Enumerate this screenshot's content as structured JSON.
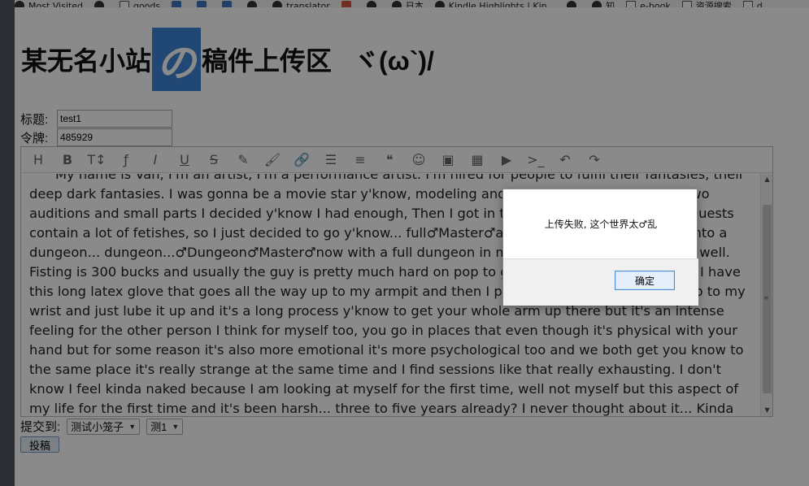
{
  "bookmarks": [
    {
      "label": "Most Visited",
      "icon": "gear-icon"
    },
    {
      "label": "",
      "icon": "github-icon"
    },
    {
      "label": "goods",
      "icon": "folder-icon"
    },
    {
      "label": "",
      "icon": "mail-icon"
    },
    {
      "label": "",
      "icon": "translate-icon"
    },
    {
      "label": "",
      "icon": "bookmark-icon"
    },
    {
      "label": "",
      "icon": "github-icon"
    },
    {
      "label": "translator",
      "icon": "globe-icon"
    },
    {
      "label": "",
      "icon": "weibo-icon"
    },
    {
      "label": "",
      "icon": "globe-icon"
    },
    {
      "label": "日本",
      "icon": "globe-icon"
    },
    {
      "label": "Kindle Highlights | Kin...",
      "icon": "globe-icon"
    },
    {
      "label": "",
      "icon": "globe-icon"
    },
    {
      "label": "知",
      "icon": "globe-icon"
    },
    {
      "label": "e-book",
      "icon": "folder-icon"
    },
    {
      "label": "资源搜索",
      "icon": "folder-icon"
    },
    {
      "label": "d",
      "icon": "folder-icon"
    }
  ],
  "header": {
    "title_prefix": "某无名小站",
    "logo_glyph": "の",
    "title_suffix": "稿件上传区",
    "face": "ヾ(ω`)/"
  },
  "form": {
    "title_label": "标题:",
    "title_value": "test1",
    "token_label": "令牌:",
    "token_value": "485929",
    "submit_to_label": "提交到:",
    "category_selected": "测试小笼子",
    "subcategory_selected": "测1",
    "post_button": "投稿"
  },
  "toolbar": [
    {
      "icon": "heading-icon",
      "glyph": "H"
    },
    {
      "icon": "bold-icon",
      "glyph": "B"
    },
    {
      "icon": "text-size-icon",
      "glyph": "T↕"
    },
    {
      "icon": "font-icon",
      "glyph": "ƒ"
    },
    {
      "icon": "italic-icon",
      "glyph": "I"
    },
    {
      "icon": "underline-icon",
      "glyph": "U"
    },
    {
      "icon": "strikethrough-icon",
      "glyph": "S"
    },
    {
      "icon": "highlighter-icon",
      "glyph": "✎"
    },
    {
      "icon": "brush-icon",
      "glyph": "🖌"
    },
    {
      "icon": "link-icon",
      "glyph": "🔗"
    },
    {
      "icon": "list-icon",
      "glyph": "☰"
    },
    {
      "icon": "align-icon",
      "glyph": "≡"
    },
    {
      "icon": "quote-icon",
      "glyph": "❝"
    },
    {
      "icon": "emoji-icon",
      "glyph": "☺"
    },
    {
      "icon": "image-icon",
      "glyph": "▣"
    },
    {
      "icon": "table-icon",
      "glyph": "▦"
    },
    {
      "icon": "video-icon",
      "glyph": "▶"
    },
    {
      "icon": "code-icon",
      "glyph": ">_"
    },
    {
      "icon": "undo-icon",
      "glyph": "↶"
    },
    {
      "icon": "redo-icon",
      "glyph": "↷"
    }
  ],
  "editor": {
    "content": "My name is Van, I'm an artist, I'm a performance artist. I'm hired for people to fulfil their fantasies, their deep dark fantasies. I was gonna be a movie star y'know, modeling and acting. After a hundred or two auditions and small parts I decided y'know I had enough, Then I got in to Escort world. The client requests contain a lot of fetishes, so I just decided to go y'know... full♂Master♂and change my entire house into a dungeon... dungeon...♂Dungeon♂Master♂now with a full dungeon in my house and It's going really well. Fisting is 300 bucks and usually the guy is pretty much hard on pop to get really relaxed y'know and I have this long latex glove that goes all the way up to my armpit and then I put on a surgical latex glove up to my wrist and just lube it up and it's a long process y'know to get your whole arm up there but it's an intense feeling for the other person I think for myself too, you go in places that even though it's physical with your hand but for some reason it's also more emotional it's more psychological too and we both get you know to the same place it's really strange at the same time and I find sessions like that really exhausting. I don't know I feel kinda naked because I am looking at myself for the first time, well not myself but this aspect of my life for the first time and it's been harsh... three to five years already? I never thought about it... Kinda sad I feel kinda sad right now, I don't know why..."
  },
  "dialog": {
    "message": "上传失败, 这个世界太♂乱",
    "ok_button": "确定"
  }
}
